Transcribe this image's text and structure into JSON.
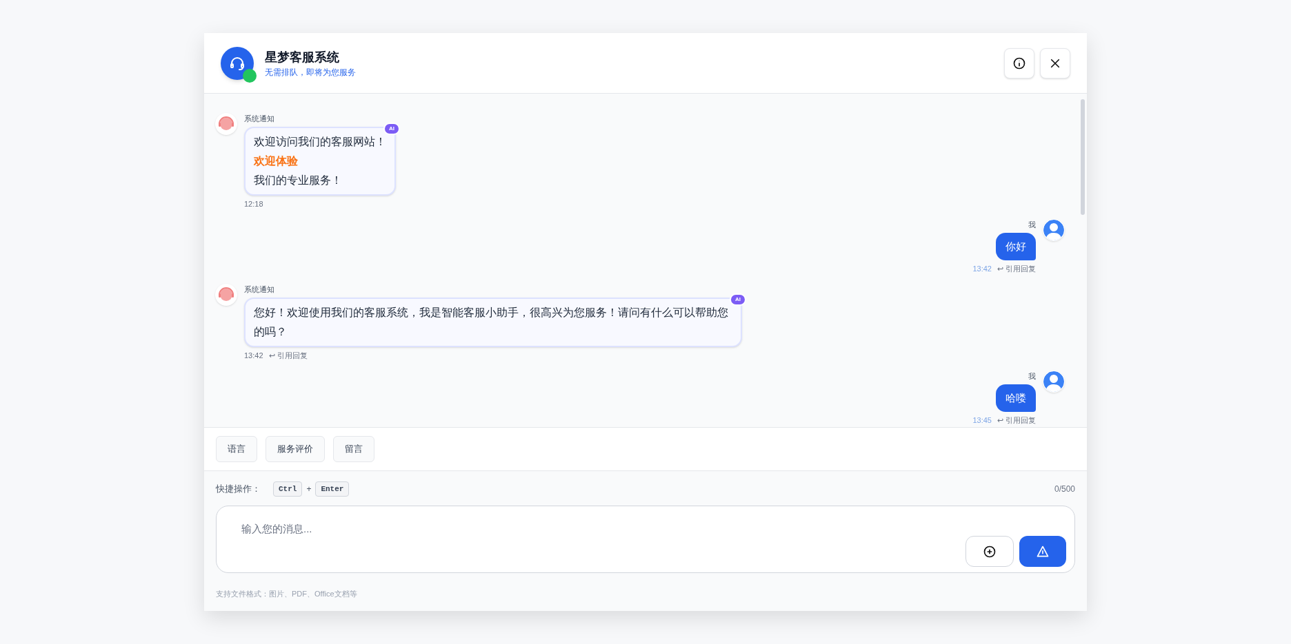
{
  "header": {
    "title": "星梦客服系统",
    "subtitle": "无需排队，即将为您服务",
    "online": true
  },
  "messages": [
    {
      "kind": "agent",
      "sender": "系统通知",
      "badge": "AI",
      "lines": [
        {
          "kind": "normal",
          "text": "欢迎访问我们的客服网站！"
        },
        {
          "kind": "highlight",
          "text": "欢迎体验"
        },
        {
          "kind": "normal",
          "text": "我们的专业服务！"
        }
      ],
      "time": "12:18"
    },
    {
      "kind": "user",
      "sender": "我",
      "lines": [
        {
          "kind": "normal",
          "text": "你好"
        }
      ],
      "time": "13:42",
      "reply": "↩ 引用回复"
    },
    {
      "kind": "agent",
      "sender": "系统通知",
      "badge": "AI",
      "lines": [
        {
          "kind": "normal",
          "text": "您好！欢迎使用我们的客服系统，我是智能客服小助手，很高兴为您服务！请问有什么可以帮助您的吗？"
        }
      ],
      "time": "13:42",
      "reply": "↩ 引用回复"
    },
    {
      "kind": "user",
      "sender": "我",
      "lines": [
        {
          "kind": "normal",
          "text": "哈喽"
        }
      ],
      "time": "13:45",
      "reply": "↩ 引用回复"
    }
  ],
  "quick_buttons": [
    "语言",
    "服务评价",
    "留言"
  ],
  "shortcut": {
    "label": "快捷操作：",
    "keys": [
      "Ctrl",
      "Enter"
    ],
    "joiner": "+"
  },
  "counter": "0/500",
  "input": {
    "placeholder": "输入您的消息..."
  },
  "footer_note": "支持文件格式：图片、PDF、Office文档等"
}
